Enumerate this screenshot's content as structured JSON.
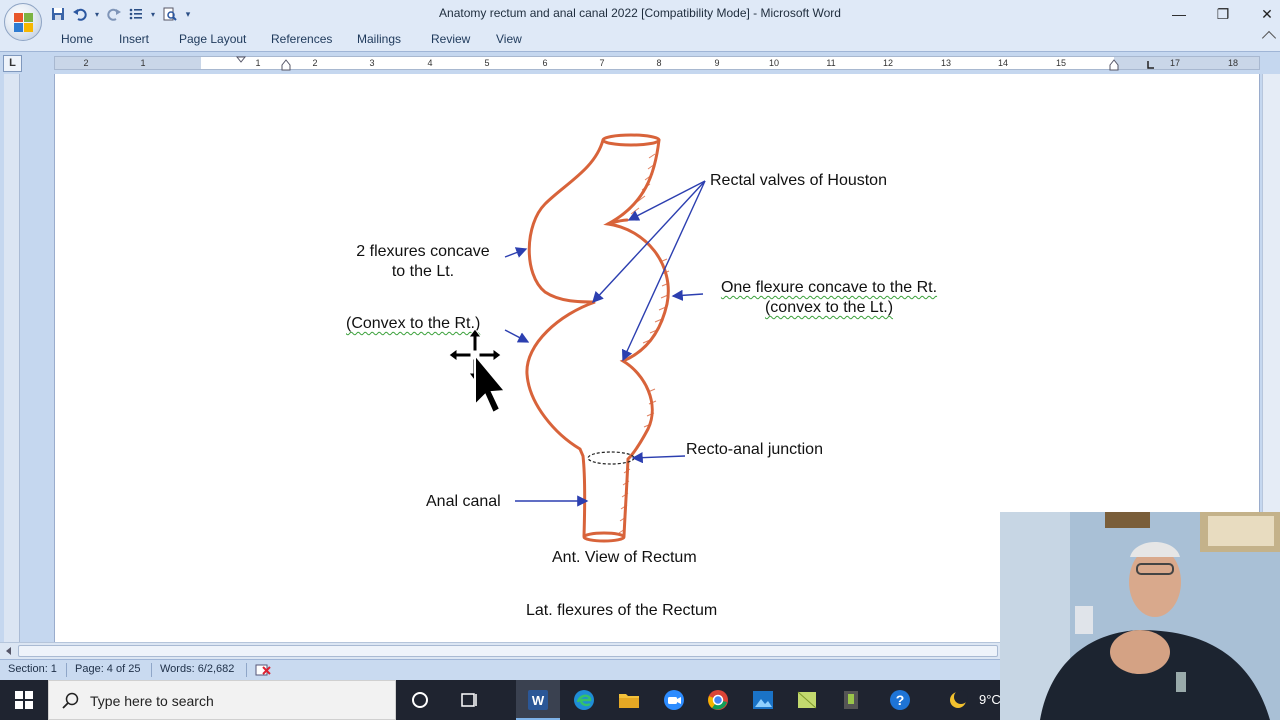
{
  "window": {
    "title": "Anatomy rectum and anal canal 2022 [Compatibility Mode] - Microsoft Word",
    "minimize": "—",
    "restore": "❐",
    "close": "✕"
  },
  "quick_access": [
    "save-icon",
    "undo-icon",
    "redo-icon",
    "bullets-icon",
    "print-preview-icon",
    "customize-icon"
  ],
  "tabs": [
    "Home",
    "Insert",
    "Page Layout",
    "References",
    "Mailings",
    "Review",
    "View"
  ],
  "ruler": {
    "corner": "L",
    "numbers": [
      "2",
      "1",
      "1",
      "2",
      "3",
      "4",
      "5",
      "6",
      "7",
      "8",
      "9",
      "10",
      "11",
      "12",
      "13",
      "14",
      "15",
      "17",
      "18"
    ]
  },
  "document": {
    "labels": {
      "rectal_valves": "Rectal valves of Houston",
      "two_flexures_line1": "2 flexures concave",
      "two_flexures_line2": "to the Lt.",
      "convex_rt": "(Convex to the Rt.)",
      "one_flexure_line1": "One flexure concave to the Rt.",
      "one_flexure_line2": "(convex to the Lt.)",
      "recto_anal": "Recto-anal junction",
      "anal_canal": "Anal canal",
      "caption": "Ant. View of Rectum",
      "subtitle": "Lat. flexures of the Rectum"
    },
    "outline_color": "#d8633a",
    "arrow_color": "#2c3fb0"
  },
  "statusbar": {
    "section": "Section: 1",
    "page": "Page: 4 of 25",
    "words": "Words: 6/2,682"
  },
  "taskbar": {
    "search_placeholder": "Type here to search",
    "temperature": "9°C",
    "apps": [
      "cortana-icon",
      "task-view-icon",
      "word-icon",
      "edge-icon",
      "file-explorer-icon",
      "zoom-icon",
      "chrome-icon",
      "photos-icon",
      "sticky-icon",
      "app-icon",
      "help-icon"
    ]
  }
}
